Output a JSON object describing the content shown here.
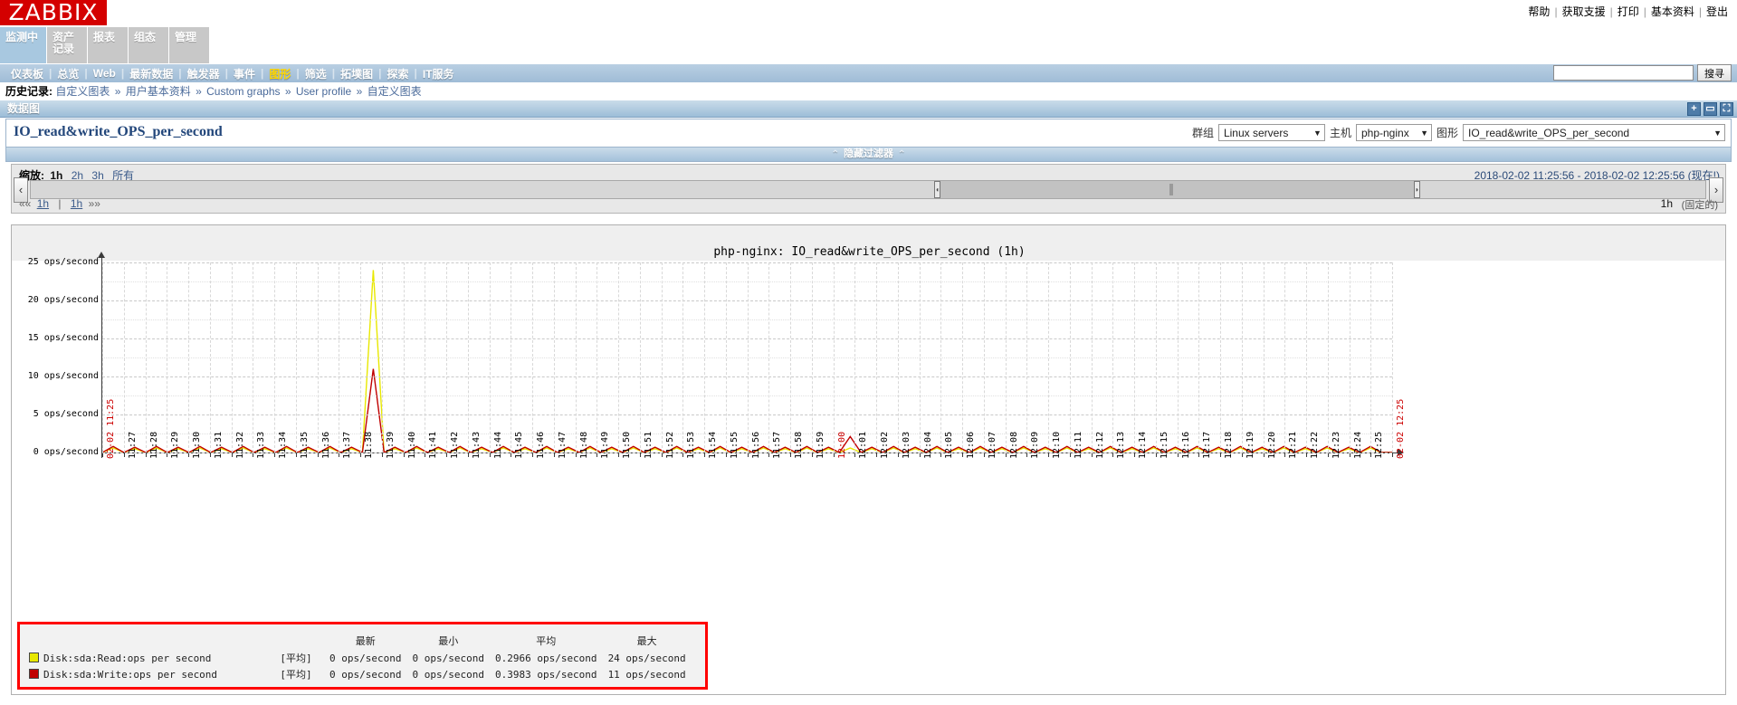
{
  "brand": {
    "logo_text": "ZABBIX"
  },
  "header": {
    "links": [
      {
        "label": "帮助"
      },
      {
        "label": "获取支援"
      },
      {
        "label": "打印"
      },
      {
        "label": "基本资料"
      },
      {
        "label": "登出"
      }
    ]
  },
  "main_tabs": [
    {
      "label": "监测中",
      "active": true
    },
    {
      "label": "资产记录",
      "active": false
    },
    {
      "label": "报表",
      "active": false
    },
    {
      "label": "组态",
      "active": false
    },
    {
      "label": "管理",
      "active": false
    }
  ],
  "subnav": [
    {
      "label": "仪表板",
      "active": false
    },
    {
      "label": "总览",
      "active": false
    },
    {
      "label": "Web",
      "active": false
    },
    {
      "label": "最新数据",
      "active": false
    },
    {
      "label": "触发器",
      "active": false
    },
    {
      "label": "事件",
      "active": false
    },
    {
      "label": "图形",
      "active": true
    },
    {
      "label": "筛选",
      "active": false
    },
    {
      "label": "拓墣图",
      "active": false
    },
    {
      "label": "探索",
      "active": false
    },
    {
      "label": "IT服务",
      "active": false
    }
  ],
  "search": {
    "value": "",
    "button_label": "搜寻"
  },
  "breadcrumb": {
    "label": "历史记录:",
    "items": [
      "自定义图表",
      "用户基本资料",
      "Custom graphs",
      "User profile",
      "自定义图表"
    ],
    "separator": "»"
  },
  "page": {
    "section_title": "数据图",
    "graph_title": "IO_read&write_OPS_per_second",
    "filter_toggle": "隐藏过滤器"
  },
  "selectors": {
    "group_label": "群组",
    "group_value": "Linux servers",
    "host_label": "主机",
    "host_value": "php-nginx",
    "graph_label": "图形",
    "graph_value": "IO_read&write_OPS_per_second",
    "caret": "▼"
  },
  "time_controls": {
    "zoom_label": "缩放:",
    "zoom_options": [
      "1h",
      "2h",
      "3h",
      "所有"
    ],
    "zoom_selected": "1h",
    "range_from": "2018-02-02 11:25:56",
    "range_dash": "-",
    "range_to": "2018-02-02 12:25:56",
    "range_now": "(现在!)",
    "nav_prev_icon": "««",
    "nav_prev_step": "1h",
    "nav_pipe": "|",
    "nav_next_step": "1h",
    "nav_next_icon": "»»",
    "fixed_span": "1h",
    "fixed_label": "(固定的)",
    "scroll_left_icon": "‹",
    "scroll_right_icon": "›"
  },
  "title_icons": [
    {
      "name": "add-icon",
      "glyph": "+"
    },
    {
      "name": "collapse-icon",
      "glyph": "▭"
    },
    {
      "name": "fullscreen-icon",
      "glyph": "⛶"
    }
  ],
  "chart_data": {
    "type": "line",
    "title": "php-nginx: IO_read&write_OPS_per_second  (1h)",
    "xlabel": "",
    "ylabel": "",
    "ylim": [
      0,
      25
    ],
    "yticks": [
      0,
      5,
      10,
      15,
      20,
      25
    ],
    "ytick_labels": [
      "0 ops/second",
      "5 ops/second",
      "10 ops/second",
      "15 ops/second",
      "20 ops/second",
      "25 ops/second"
    ],
    "y_unit": "ops/second",
    "grid": true,
    "legend_position": "bottom",
    "x_start_label": "02-02 11:25",
    "x_end_label": "02-02 12:25",
    "xtick_labels": [
      "02-02 11:25",
      "11:27",
      "11:28",
      "11:29",
      "11:30",
      "11:31",
      "11:32",
      "11:33",
      "11:34",
      "11:35",
      "11:36",
      "11:37",
      "11:38",
      "11:39",
      "11:40",
      "11:41",
      "11:42",
      "11:43",
      "11:44",
      "11:45",
      "11:46",
      "11:47",
      "11:48",
      "11:49",
      "11:50",
      "11:51",
      "11:52",
      "11:53",
      "11:54",
      "11:55",
      "11:56",
      "11:57",
      "11:58",
      "11:59",
      "12:00",
      "12:01",
      "12:02",
      "12:03",
      "12:04",
      "12:05",
      "12:06",
      "12:07",
      "12:08",
      "12:09",
      "12:10",
      "12:11",
      "12:12",
      "12:13",
      "12:14",
      "12:15",
      "12:16",
      "12:17",
      "12:18",
      "12:19",
      "12:20",
      "12:21",
      "12:22",
      "12:23",
      "12:24",
      "12:25",
      "02-02 12:25"
    ],
    "series": [
      {
        "name": "Disk:sda:Read:ops per second",
        "color": "#e8e800",
        "aggregation": "[平均]",
        "last": "0 ops/second",
        "min": "0 ops/second",
        "avg": "0.2966 ops/second",
        "max": "24 ops/second",
        "values": [
          0,
          0.6,
          0,
          0.5,
          0,
          0.6,
          0,
          0.5,
          0,
          0.6,
          0,
          0.5,
          0,
          0.6,
          0,
          0.5,
          0,
          0.6,
          0,
          0.5,
          0,
          0.6,
          0,
          0.5,
          0,
          24,
          0,
          0.5,
          0,
          0.6,
          0,
          0.5,
          0,
          0.6,
          0,
          0.5,
          0,
          0.6,
          0,
          0.5,
          0,
          0.6,
          0,
          0.5,
          0,
          0.6,
          0,
          0.5,
          0,
          0.6,
          0,
          0.5,
          0,
          0.6,
          0,
          0.5,
          0,
          0.6,
          0,
          0.5,
          0,
          0.6,
          0,
          0.5,
          0,
          0.6,
          0,
          0.5,
          0,
          0.6,
          0,
          0.5,
          0,
          0.6,
          0,
          0.5,
          0,
          0.6,
          0,
          0.5,
          0,
          0.6,
          0,
          0.5,
          0,
          0.6,
          0,
          0.5,
          0,
          0.6,
          0,
          0.5,
          0,
          0.6,
          0,
          0.5,
          0,
          0.6,
          0,
          0.5,
          0,
          0.6,
          0,
          0.5,
          0,
          0.6,
          0,
          0.5,
          0,
          0.6,
          0,
          0.5,
          0,
          0.6,
          0,
          0.5,
          0,
          0.6,
          0,
          0
        ]
      },
      {
        "name": "Disk:sda:Write:ops per second",
        "color": "#c00000",
        "aggregation": "[平均]",
        "last": "0 ops/second",
        "min": "0 ops/second",
        "avg": "0.3983 ops/second",
        "max": "11 ops/second",
        "values": [
          0,
          0.8,
          0,
          0.7,
          0,
          0.8,
          0,
          0.7,
          0,
          0.8,
          0,
          0.7,
          0,
          0.8,
          0,
          0.7,
          0,
          0.8,
          0,
          0.7,
          0,
          0.8,
          0,
          0.7,
          0,
          11,
          0,
          0.7,
          0,
          0.8,
          0,
          0.7,
          0,
          0.8,
          0,
          0.7,
          0,
          0.8,
          0,
          0.7,
          0,
          0.8,
          0,
          0.7,
          0,
          0.8,
          0,
          0.7,
          0,
          0.8,
          0,
          0.7,
          0,
          0.8,
          0,
          0.7,
          0,
          0.8,
          0,
          0.7,
          0,
          0.8,
          0,
          0.7,
          0,
          0.8,
          0,
          0.7,
          0,
          2.1,
          0,
          0.7,
          0,
          0.8,
          0,
          0.7,
          0,
          0.8,
          0,
          0.7,
          0,
          0.8,
          0,
          0.7,
          0,
          0.8,
          0,
          0.7,
          0,
          0.8,
          0,
          0.7,
          0,
          0.8,
          0,
          0.7,
          0,
          0.8,
          0,
          0.7,
          0,
          0.8,
          0,
          0.7,
          0,
          0.8,
          0,
          0.7,
          0,
          0.8,
          0,
          0.7,
          0,
          0.8,
          0,
          0.7,
          0,
          0.8,
          0,
          0
        ]
      }
    ],
    "legend_headers": [
      "",
      "",
      "最新",
      "最小",
      "平均",
      "最大"
    ],
    "legend_col_labels": {
      "last": "最新",
      "min": "最小",
      "avg": "平均",
      "max": "最大"
    }
  },
  "footer": {
    "note": ""
  }
}
